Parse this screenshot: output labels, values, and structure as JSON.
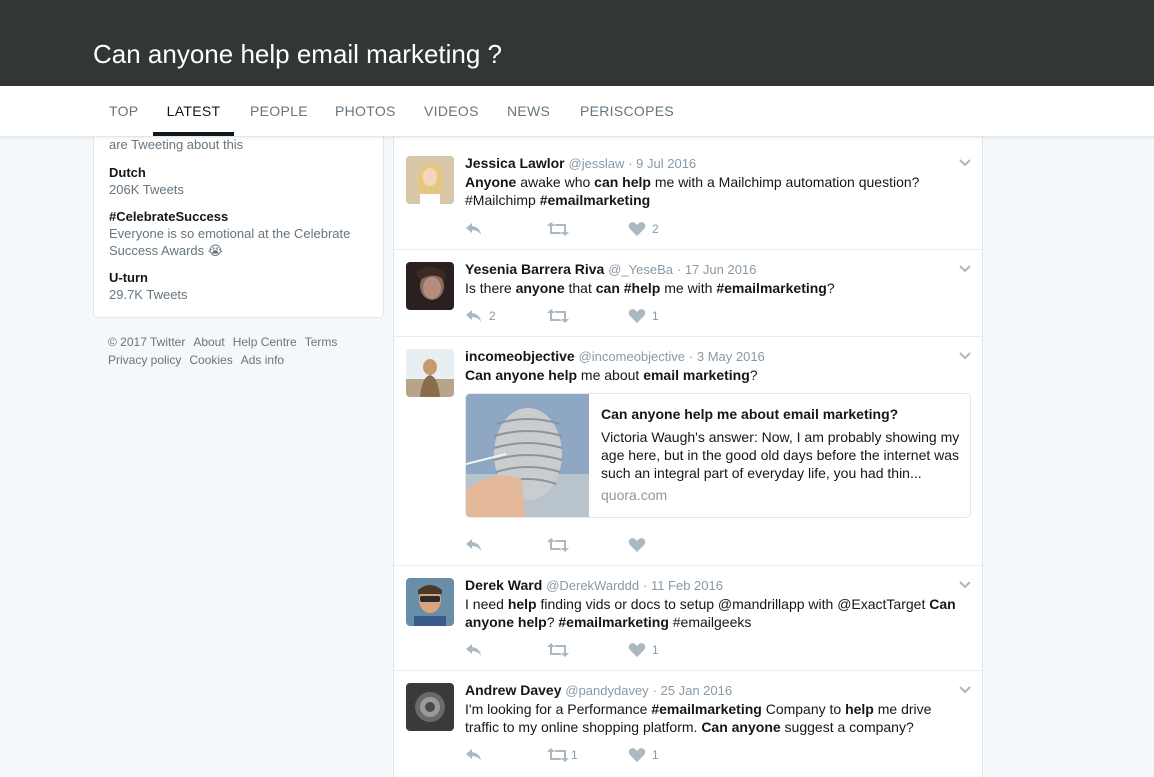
{
  "search": {
    "title": "Can anyone help email marketing ?"
  },
  "nav": {
    "tabs": [
      {
        "label": "TOP"
      },
      {
        "label": "LATEST"
      },
      {
        "label": "PEOPLE"
      },
      {
        "label": "PHOTOS"
      },
      {
        "label": "VIDEOS"
      },
      {
        "label": "NEWS"
      },
      {
        "label": "PERISCOPES"
      }
    ],
    "active": "LATEST"
  },
  "trends": {
    "top_sub": "are Tweeting about this",
    "items": [
      {
        "name": "Dutch",
        "meta": "206K Tweets"
      },
      {
        "name": "#CelebrateSuccess",
        "meta": "Everyone is so emotional at the Celebrate Success Awards 😭"
      },
      {
        "name": "U-turn",
        "meta": "29.7K Tweets"
      }
    ]
  },
  "footer": {
    "links": [
      "© 2017 Twitter",
      "About",
      "Help Centre",
      "Terms",
      "Privacy policy",
      "Cookies",
      "Ads info"
    ]
  },
  "tweets": [
    {
      "name": "Jessica Lawlor",
      "handle": "@jesslaw",
      "date": "· 9 Jul 2016",
      "text_html": "<b>Anyone</b> awake who <b>can help</b> me with a Mailchimp automation question? #Mailchimp <b>#emailmarketing</b>",
      "replies": "",
      "retweets": "",
      "likes": "2"
    },
    {
      "name": "Yesenia Barrera Riva",
      "handle": "@_YeseBa",
      "date": "· 17 Jun 2016",
      "text_html": "Is there <b>anyone</b> that <b>can</b> <b>#help</b> me with <b>#emailmarketing</b>?",
      "replies": "2",
      "retweets": "",
      "likes": "1"
    },
    {
      "name": "incomeobjective",
      "handle": "@incomeobjective",
      "date": "· 3 May 2016",
      "text_html": "<b>Can anyone help</b> me about <b>email marketing</b>?",
      "replies": "",
      "retweets": "",
      "likes": "",
      "card": {
        "title": "Can anyone help me about email marketing?",
        "desc": "Victoria Waugh's answer: Now, I am probably showing my age here, but in the good old days before the internet was such an integral part of everyday life, you had thin...",
        "host": "quora.com"
      }
    },
    {
      "name": "Derek Ward",
      "handle": "@DerekWarddd",
      "date": "· 11 Feb 2016",
      "text_html": "I need <b>help</b> finding vids or docs to setup @mandrillapp with @ExactTarget <b>Can anyone help</b>? <b>#emailmarketing</b> #emailgeeks",
      "replies": "",
      "retweets": "",
      "likes": "1"
    },
    {
      "name": "Andrew Davey",
      "handle": "@pandydavey",
      "date": "· 25 Jan 2016",
      "text_html": "I'm looking for a Performance <b>#emailmarketing</b> Company to <b>help</b> me drive traffic to my online shopping platform. <b>Can anyone</b> suggest a company?",
      "replies": "",
      "retweets": "1",
      "likes": "1"
    }
  ],
  "colors": {
    "header_bg": "#323636",
    "page_bg": "#f5f8fa",
    "icon_gray": "#aab8c2",
    "link_gray": "#66757f"
  }
}
